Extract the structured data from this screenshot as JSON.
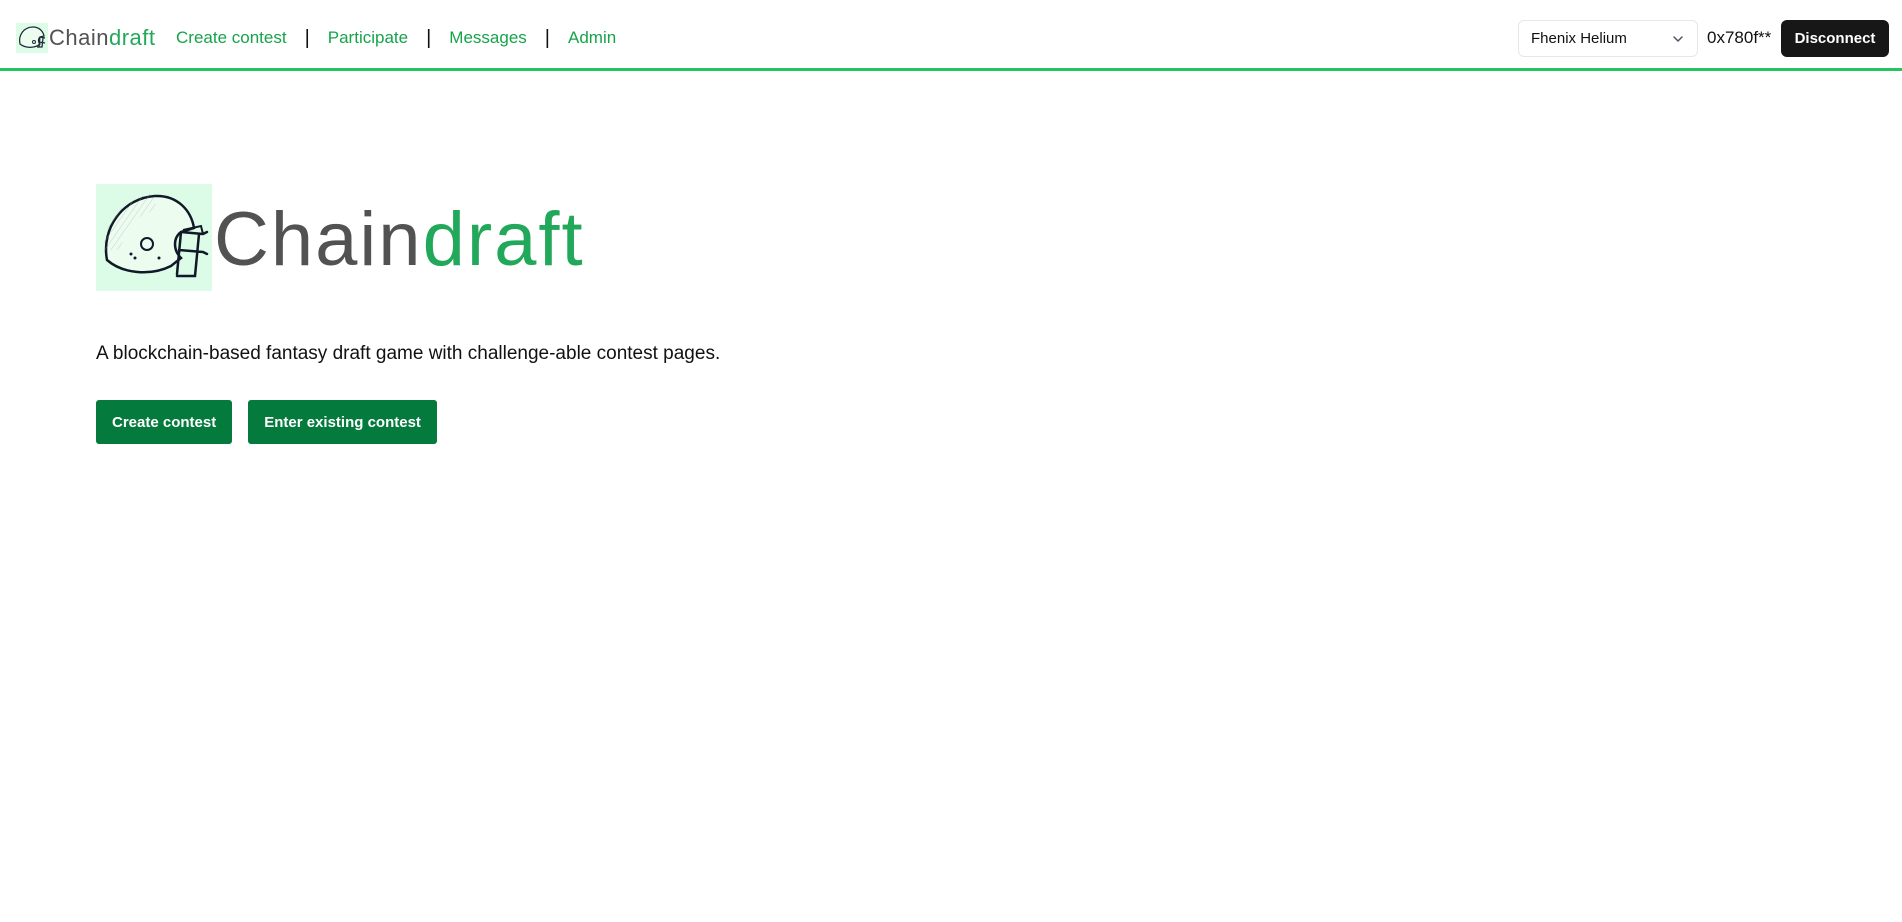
{
  "brand": {
    "word1": "Chain",
    "word2": "draft",
    "logo_icon": "football-helmet-icon",
    "color_primary_text": "#525252",
    "color_accent": "#22a85a",
    "logo_bg": "#dcfce7"
  },
  "nav": {
    "links": [
      {
        "label": "Create contest"
      },
      {
        "label": "Participate"
      },
      {
        "label": "Messages"
      },
      {
        "label": "Admin"
      }
    ],
    "separator": "|",
    "link_color": "#16a34a",
    "accent_border": "#22c55e"
  },
  "wallet": {
    "network_selected": "Fhenix Helium",
    "network_icon": "chevron-down-icon",
    "address": "0x780f**",
    "disconnect_label": "Disconnect"
  },
  "hero": {
    "tagline": "A blockchain-based fantasy draft game with challenge-able contest pages.",
    "buttons": [
      {
        "label": "Create contest"
      },
      {
        "label": "Enter existing contest"
      }
    ],
    "button_color": "#047a3d"
  }
}
